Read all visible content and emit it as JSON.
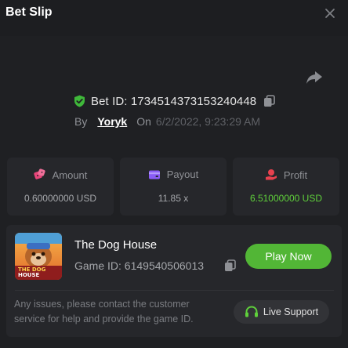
{
  "header": {
    "title": "Bet Slip"
  },
  "bet": {
    "id_text": "Bet ID: 1734514373153240448",
    "by_label": "By",
    "user": "Yoryk",
    "on_label": "On",
    "date": "6/2/2022, 9:23:29 AM"
  },
  "stats": [
    {
      "label": "Amount",
      "value": "0.60000000 USD",
      "icon": "dice-icon",
      "icon_color": "#e8457a"
    },
    {
      "label": "Payout",
      "value": "11.85 x",
      "icon": "wallet-icon",
      "icon_color": "#8a5cf5"
    },
    {
      "label": "Profit",
      "value": "6.51000000 USD",
      "icon": "coin-hand-icon",
      "icon_color": "#e8414e",
      "value_color": "#5fd03b"
    }
  ],
  "game": {
    "name": "The Dog House",
    "id_text": "Game ID: 6149540506013",
    "play_label": "Play Now",
    "thumb_text_top": "THE DOG",
    "thumb_text_bottom": "HOUSE"
  },
  "footer": {
    "issues_text": "Any issues, please contact the customer service for help and provide the game ID.",
    "support_label": "Live Support"
  },
  "colors": {
    "accent": "#52b636",
    "profit": "#5fd03b",
    "shield": "#3fb83a"
  }
}
